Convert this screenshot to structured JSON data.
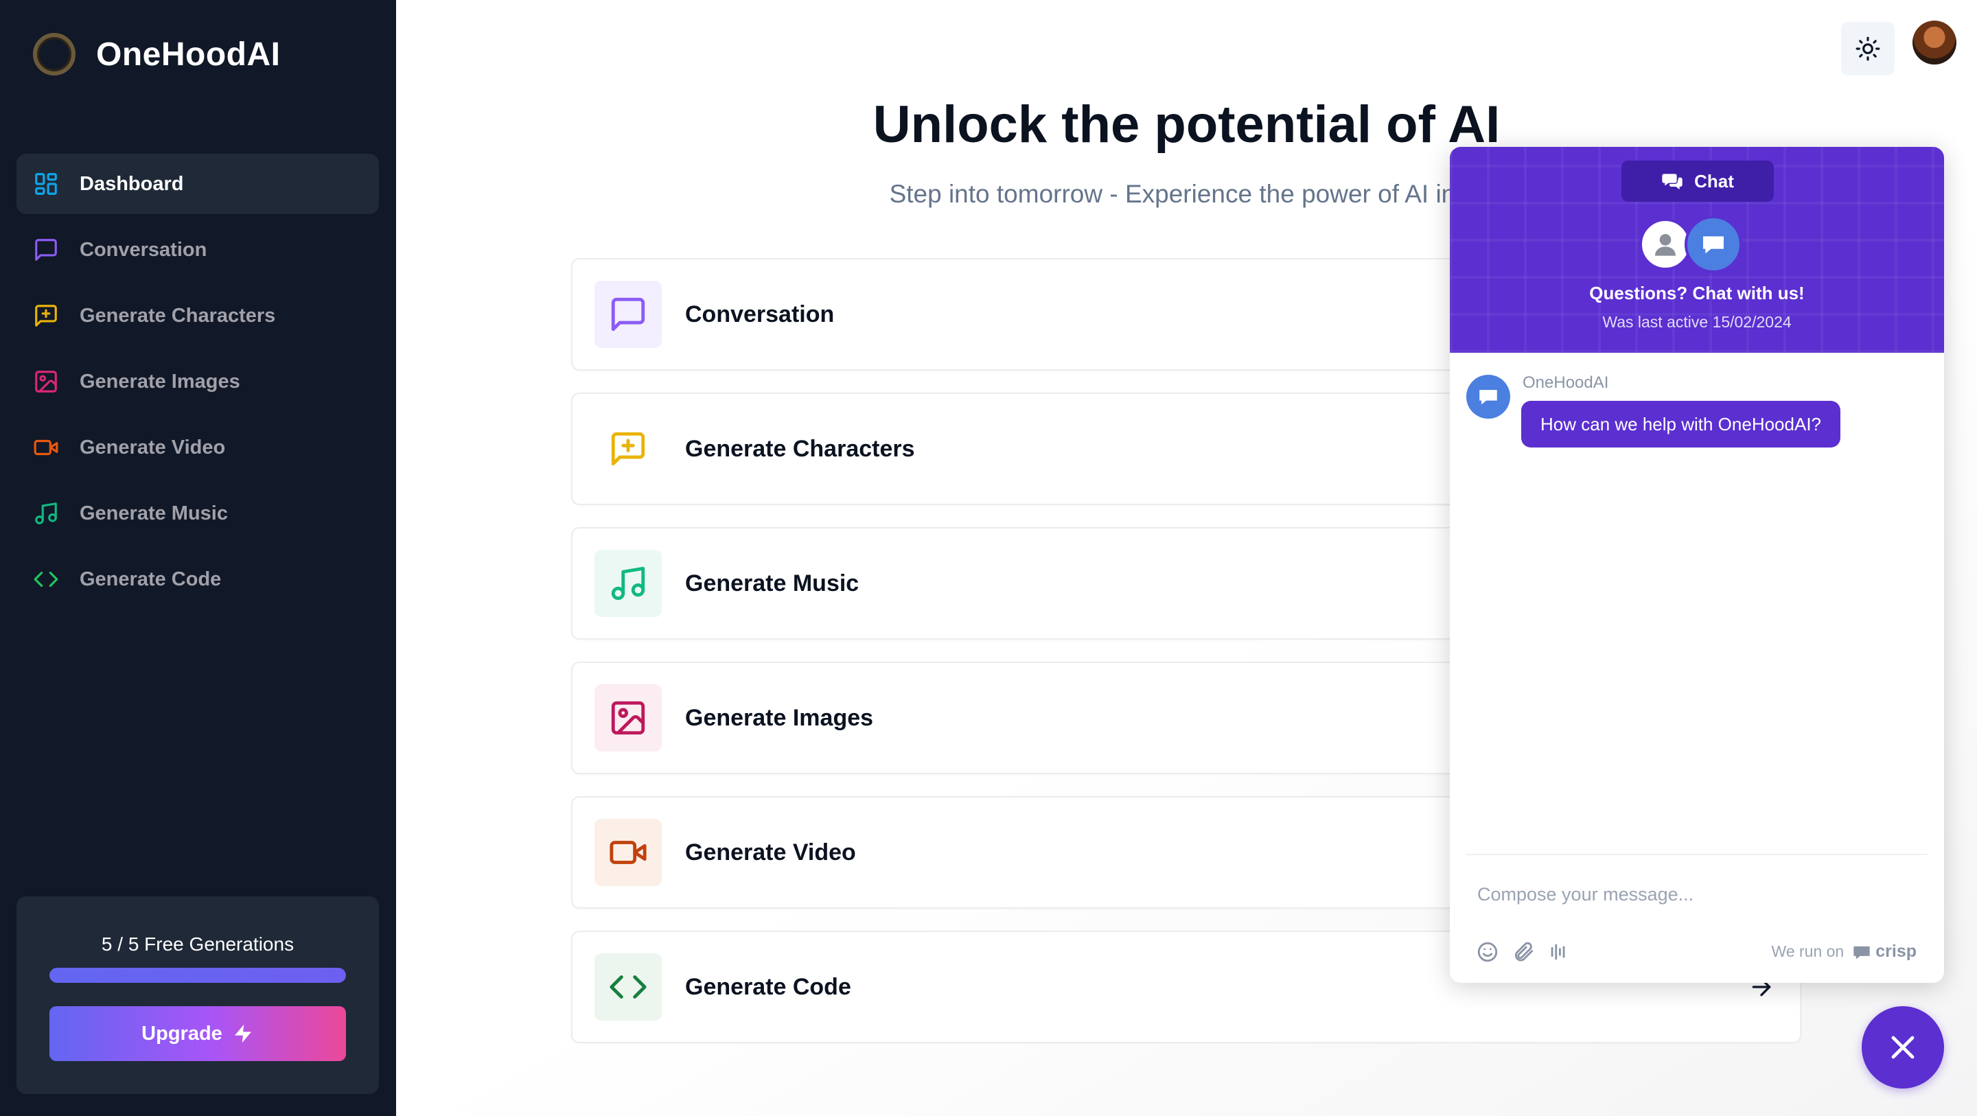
{
  "app": {
    "name": "OneHoodAI"
  },
  "sidebar": {
    "items": [
      {
        "label": "Dashboard",
        "icon": "layout-dashboard-icon",
        "color": "#0ea5e9",
        "active": true
      },
      {
        "label": "Conversation",
        "icon": "message-square-icon",
        "color": "#8b5cf6"
      },
      {
        "label": "Generate Characters",
        "icon": "message-square-plus-icon",
        "color": "#eab308"
      },
      {
        "label": "Generate Images",
        "icon": "image-icon",
        "color": "#db2777"
      },
      {
        "label": "Generate Video",
        "icon": "video-icon",
        "color": "#ea580c"
      },
      {
        "label": "Generate Music",
        "icon": "music-icon",
        "color": "#10b981"
      },
      {
        "label": "Generate Code",
        "icon": "code-icon",
        "color": "#22c55e"
      }
    ],
    "credits": {
      "label": "5 / 5 Free Generations",
      "used": 5,
      "max": 5
    },
    "upgrade_label": "Upgrade"
  },
  "header": {
    "theme_toggle_icon": "sun-icon"
  },
  "hero": {
    "title": "Unlock the potential of AI",
    "subtitle": "Step into tomorrow - Experience the power of AI inno"
  },
  "tools": [
    {
      "label": "Conversation",
      "icon": "message-square-icon",
      "color": "#8b5cf6",
      "bg": "#f3effe"
    },
    {
      "label": "Generate Characters",
      "icon": "message-square-plus-icon",
      "color": "#eab308",
      "bg": "#ffffff"
    },
    {
      "label": "Generate Music",
      "icon": "music-icon",
      "color": "#10b981",
      "bg": "#ecf8f3"
    },
    {
      "label": "Generate Images",
      "icon": "image-icon",
      "color": "#be185d",
      "bg": "#fbedf2"
    },
    {
      "label": "Generate Video",
      "icon": "video-icon",
      "color": "#c2410c",
      "bg": "#fbefe8"
    },
    {
      "label": "Generate Code",
      "icon": "code-icon",
      "color": "#15803d",
      "bg": "#edf5ef"
    }
  ],
  "chat": {
    "tab_label": "Chat",
    "headline": "Questions? Chat with us!",
    "last_active": "Was last active 15/02/2024",
    "sender": "OneHoodAI",
    "message": "How can we help with OneHoodAI?",
    "compose_placeholder": "Compose your message...",
    "powered_prefix": "We run on",
    "powered_brand": "crisp",
    "accent": "#5b2fd0"
  }
}
